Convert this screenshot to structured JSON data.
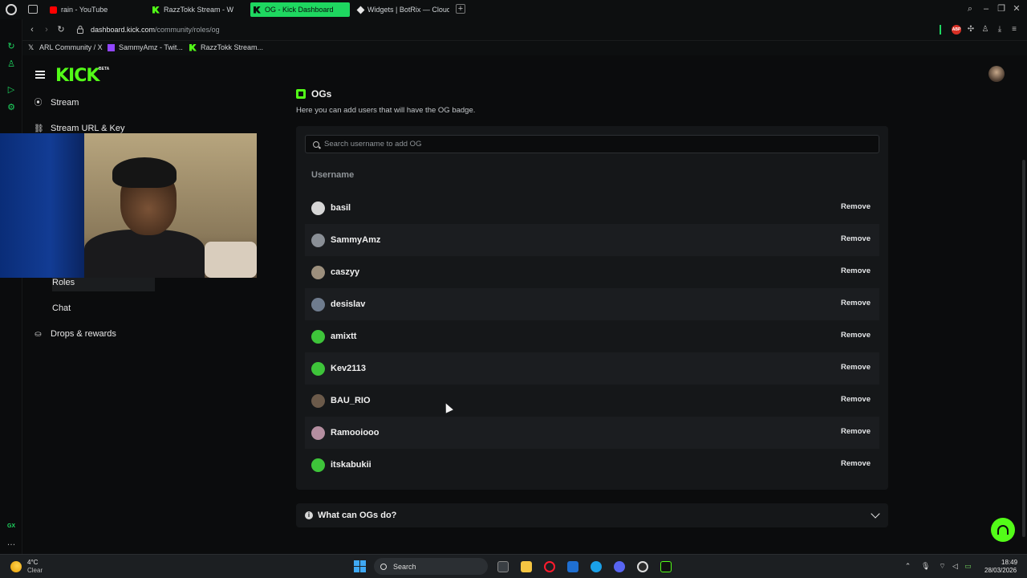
{
  "browser": {
    "tabs": [
      {
        "label": "rain - YouTube",
        "favicon": "youtube-icon"
      },
      {
        "label": "RazzTokk Stream - W",
        "favicon": "kick-icon"
      },
      {
        "label": "OG - Kick Dashboard",
        "favicon": "kick-icon",
        "active": true
      },
      {
        "label": "Widgets | BotRix — Cloud",
        "favicon": "botrix-icon"
      }
    ],
    "url_host": "dashboard.kick.com",
    "url_path": "/community/roles/og",
    "bookmarks": [
      {
        "label": "ARL Community / X",
        "icon": "x-icon"
      },
      {
        "label": "SammyAmz - Twit...",
        "icon": "twitch-icon"
      },
      {
        "label": "RazzTokk Stream...",
        "icon": "kick-icon"
      }
    ]
  },
  "kick": {
    "logo": "KICK",
    "logo_badge": "BETA",
    "nav": {
      "stream": "Stream",
      "stream_url_key": "Stream URL & Key",
      "roles": "Roles",
      "chat": "Chat",
      "drops": "Drops & rewards"
    },
    "page": {
      "title": "OGs",
      "description": "Here you can add users that will have the OG badge.",
      "search_placeholder": "Search username to add OG",
      "column_header": "Username",
      "remove_label": "Remove",
      "users": [
        {
          "name": "basil",
          "avatar_color": "#d6d6d6"
        },
        {
          "name": "SammyAmz",
          "avatar_color": "#8a8f96"
        },
        {
          "name": "caszyy",
          "avatar_color": "#9c8f7d"
        },
        {
          "name": "desislav",
          "avatar_color": "#6f7c8e"
        },
        {
          "name": "amixtt",
          "avatar_color": "#3ec43a"
        },
        {
          "name": "Kev2113",
          "avatar_color": "#3ec43a"
        },
        {
          "name": "BAU_RIO",
          "avatar_color": "#6b5a4a"
        },
        {
          "name": "Ramooiooo",
          "avatar_color": "#b48ea0"
        },
        {
          "name": "itskabukii",
          "avatar_color": "#3ec43a"
        }
      ],
      "faq_title": "What can OGs do?"
    },
    "accent_color": "#53fc18"
  },
  "taskbar": {
    "weather_temp": "4°C",
    "weather_condition": "Clear",
    "search_label": "Search",
    "time": "18:49",
    "date": "28/03/2026"
  }
}
